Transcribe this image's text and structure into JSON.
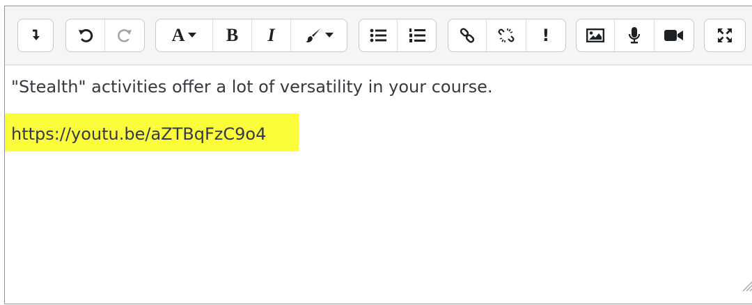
{
  "editor": {
    "toolbar": {
      "groups": [
        {
          "name": "toggle-group",
          "buttons": [
            {
              "icon": "toggle-arrow-icon",
              "label": ""
            }
          ]
        },
        {
          "name": "history-group",
          "buttons": [
            {
              "icon": "undo-icon",
              "label": ""
            },
            {
              "icon": "redo-icon",
              "label": "",
              "disabled": true
            }
          ]
        },
        {
          "name": "formatting-group",
          "buttons": [
            {
              "icon": "paragraph-style-icon",
              "label": "A"
            },
            {
              "icon": "bold-icon",
              "label": "B"
            },
            {
              "icon": "italic-icon",
              "label": "I"
            },
            {
              "icon": "brush-icon",
              "label": ""
            }
          ]
        },
        {
          "name": "lists-group",
          "buttons": [
            {
              "icon": "bulleted-list-icon",
              "label": ""
            },
            {
              "icon": "numbered-list-icon",
              "label": ""
            }
          ]
        },
        {
          "name": "links-group",
          "buttons": [
            {
              "icon": "link-icon",
              "label": ""
            },
            {
              "icon": "unlink-icon",
              "label": ""
            },
            {
              "icon": "exclamation-icon",
              "label": "!"
            }
          ]
        },
        {
          "name": "media-group",
          "buttons": [
            {
              "icon": "image-icon",
              "label": ""
            },
            {
              "icon": "microphone-icon",
              "label": ""
            },
            {
              "icon": "video-icon",
              "label": ""
            }
          ]
        },
        {
          "name": "fullscreen-group",
          "buttons": [
            {
              "icon": "fullscreen-icon",
              "label": ""
            }
          ]
        }
      ]
    },
    "content": {
      "paragraph1": "\"Stealth\" activities offer a lot of versatility in your course.",
      "link_text": "https://youtu.be/aZTBqFzC9o4"
    },
    "colors": {
      "highlight": "#fbfd3a",
      "text": "#343a40",
      "toolbar_bg": "#f5f5f5",
      "disabled_icon": "#a3a3a3"
    }
  }
}
